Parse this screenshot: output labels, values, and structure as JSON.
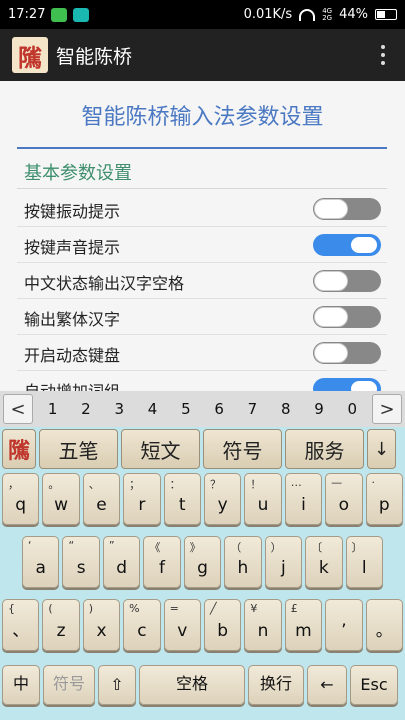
{
  "status": {
    "time": "17:27",
    "speed": "0.01K/s",
    "net": "4G\n2G",
    "battery": "44%",
    "battery_level": 0.44
  },
  "app": {
    "logo": "隲",
    "title": "智能陈桥"
  },
  "settings": {
    "page_title": "智能陈桥输入法参数设置",
    "section": "基本参数设置",
    "rows": [
      {
        "label": "按键振动提示",
        "on": false
      },
      {
        "label": "按键声音提示",
        "on": true
      },
      {
        "label": "中文状态输出汉字空格",
        "on": false
      },
      {
        "label": "输出繁体汉字",
        "on": false
      },
      {
        "label": "开启动态键盘",
        "on": false
      },
      {
        "label": "自动增加词组",
        "on": true
      }
    ]
  },
  "keyboard": {
    "left_arrow": "<",
    "right_arrow": ">",
    "candidates": [
      "1",
      "2",
      "3",
      "4",
      "5",
      "6",
      "7",
      "8",
      "9",
      "0"
    ],
    "func_logo": "隲",
    "func_keys": [
      "五笔",
      "短文",
      "符号",
      "服务"
    ],
    "func_down": "↓",
    "row1": [
      [
        "，",
        "q"
      ],
      [
        "。",
        "w"
      ],
      [
        "、",
        "e"
      ],
      [
        "；",
        "r"
      ],
      [
        "：",
        "t"
      ],
      [
        "？",
        "y"
      ],
      [
        "！",
        "u"
      ],
      [
        "…",
        "i"
      ],
      [
        "—",
        "o"
      ],
      [
        "·",
        "p"
      ]
    ],
    "row2": [
      [
        "‘",
        "a"
      ],
      [
        "“",
        "s"
      ],
      [
        "”",
        "d"
      ],
      [
        "《",
        "f"
      ],
      [
        "》",
        "g"
      ],
      [
        "（",
        "h"
      ],
      [
        "）",
        "j"
      ],
      [
        "〔",
        "k"
      ],
      [
        "〕",
        "l"
      ]
    ],
    "row3": [
      [
        "{",
        "、"
      ],
      [
        "(",
        "z"
      ],
      [
        ")",
        "x"
      ],
      [
        "%",
        "c"
      ],
      [
        "=",
        "v"
      ],
      [
        "╱",
        "b"
      ],
      [
        "¥",
        "n"
      ],
      [
        "£",
        "m"
      ],
      [
        "",
        "’"
      ],
      [
        "",
        "。"
      ]
    ],
    "bottom": [
      "中",
      "符号",
      "⇧",
      "空格",
      "换行",
      "←",
      "Esc"
    ]
  }
}
